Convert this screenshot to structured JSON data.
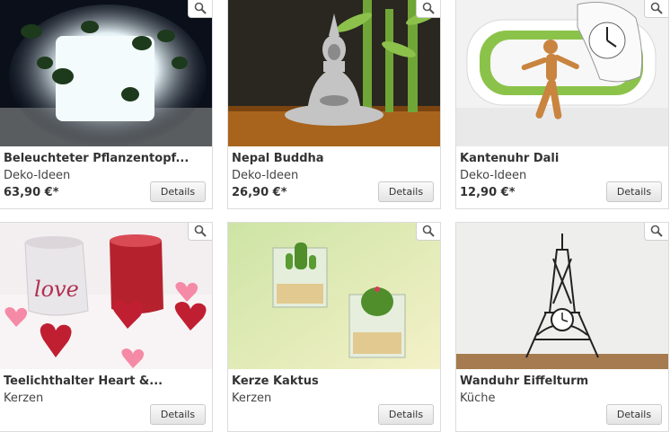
{
  "products": [
    {
      "title": "Beleuchteter Pflanzentopf...",
      "category": "Deko-Ideen",
      "price": "63,90 €*",
      "details_label": "Details"
    },
    {
      "title": "Nepal Buddha",
      "category": "Deko-Ideen",
      "price": "26,90 €*",
      "details_label": "Details"
    },
    {
      "title": "Kantenuhr Dali",
      "category": "Deko-Ideen",
      "price": "12,90 €*",
      "details_label": "Details"
    },
    {
      "title": "Teelichthalter Heart &...",
      "category": "Kerzen",
      "price": "",
      "details_label": "Details"
    },
    {
      "title": "Kerze Kaktus",
      "category": "Kerzen",
      "price": "",
      "details_label": "Details"
    },
    {
      "title": "Wanduhr Eiffelturm",
      "category": "Küche",
      "price": "",
      "details_label": "Details"
    }
  ],
  "icons": {
    "zoom": "magnifier-icon"
  },
  "colors": {
    "button_gradient_top": "#fafafa",
    "button_gradient_bottom": "#e3e3e3",
    "card_border": "#dcdcdc"
  }
}
